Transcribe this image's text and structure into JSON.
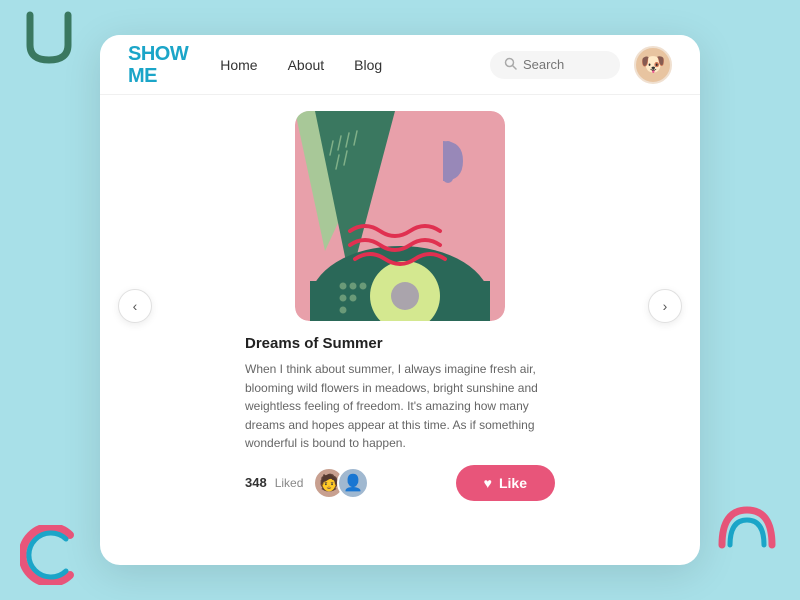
{
  "logo": {
    "line1": "SHOW",
    "line2": "ME"
  },
  "nav": {
    "home": "Home",
    "about": "About",
    "blog": "Blog"
  },
  "search": {
    "placeholder": "Search"
  },
  "artwork": {
    "title": "Dreams of Summer",
    "description": "When I think about summer, I always imagine fresh air, blooming wild flowers in meadows, bright sunshine and weightless feeling of freedom. It's amazing how many dreams and hopes appear at this time. As if something wonderful is bound to happen.",
    "liked_count": "348",
    "liked_label": "Liked"
  },
  "buttons": {
    "like": "Like",
    "prev": "‹",
    "next": "›"
  },
  "colors": {
    "background": "#a8e0e8",
    "card": "#ffffff",
    "accent_teal": "#1ba5c8",
    "accent_pink": "#e8557a",
    "art_pink": "#e8a0aa",
    "art_green_light": "#a8c898",
    "art_green_dark": "#3a7860",
    "art_teal": "#2a6858",
    "art_yellow_green": "#d4e090",
    "art_purple": "#9888b8"
  }
}
